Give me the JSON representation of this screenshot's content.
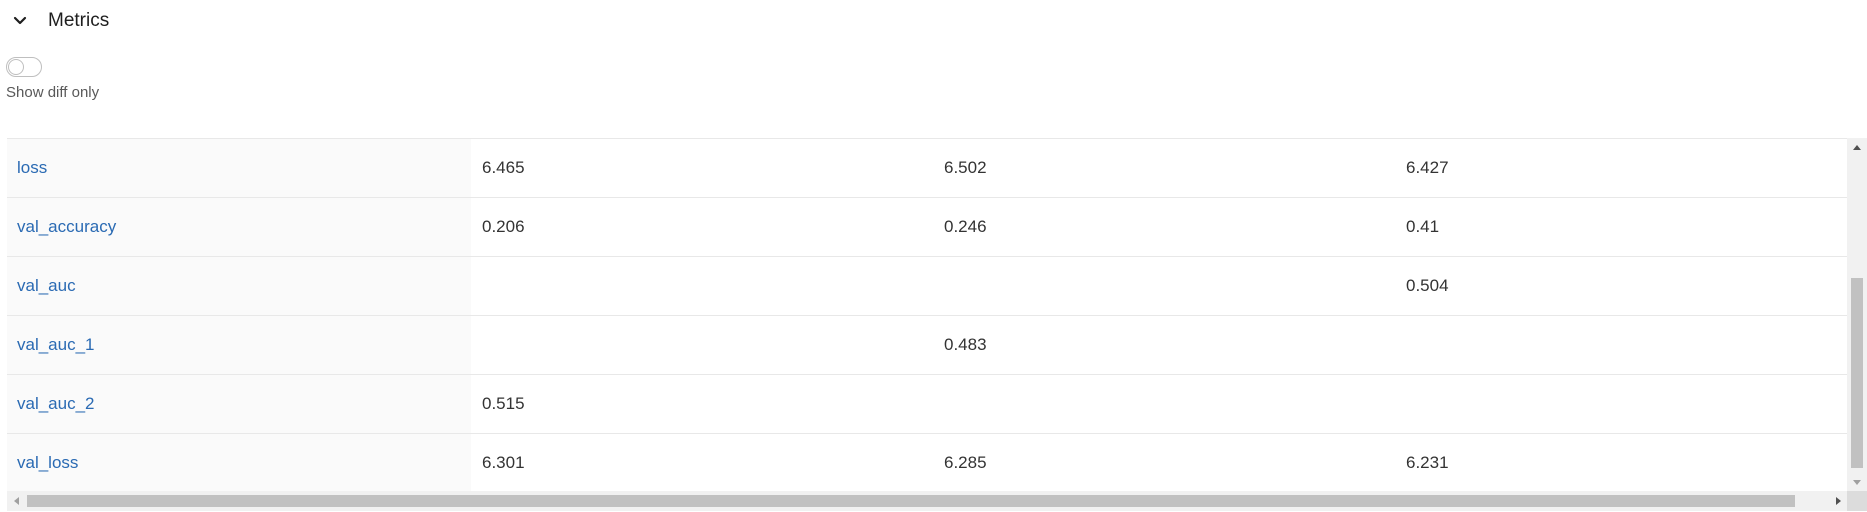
{
  "section": {
    "title": "Metrics",
    "expand_icon": "chevron-down-icon"
  },
  "diff_toggle": {
    "label": "Show diff only",
    "checked": false
  },
  "table": {
    "rows": [
      {
        "name": "loss",
        "values": [
          "6.465",
          "6.502",
          "6.427"
        ]
      },
      {
        "name": "val_accuracy",
        "values": [
          "0.206",
          "0.246",
          "0.41"
        ]
      },
      {
        "name": "val_auc",
        "values": [
          "",
          "",
          "0.504"
        ]
      },
      {
        "name": "val_auc_1",
        "values": [
          "",
          "0.483",
          ""
        ]
      },
      {
        "name": "val_auc_2",
        "values": [
          "0.515",
          "",
          ""
        ]
      },
      {
        "name": "val_loss",
        "values": [
          "6.301",
          "6.285",
          "6.231"
        ]
      }
    ]
  },
  "colors": {
    "link": "#2a6ab3",
    "name_column_bg": "#fafafa",
    "row_border": "#e8e8e8"
  }
}
